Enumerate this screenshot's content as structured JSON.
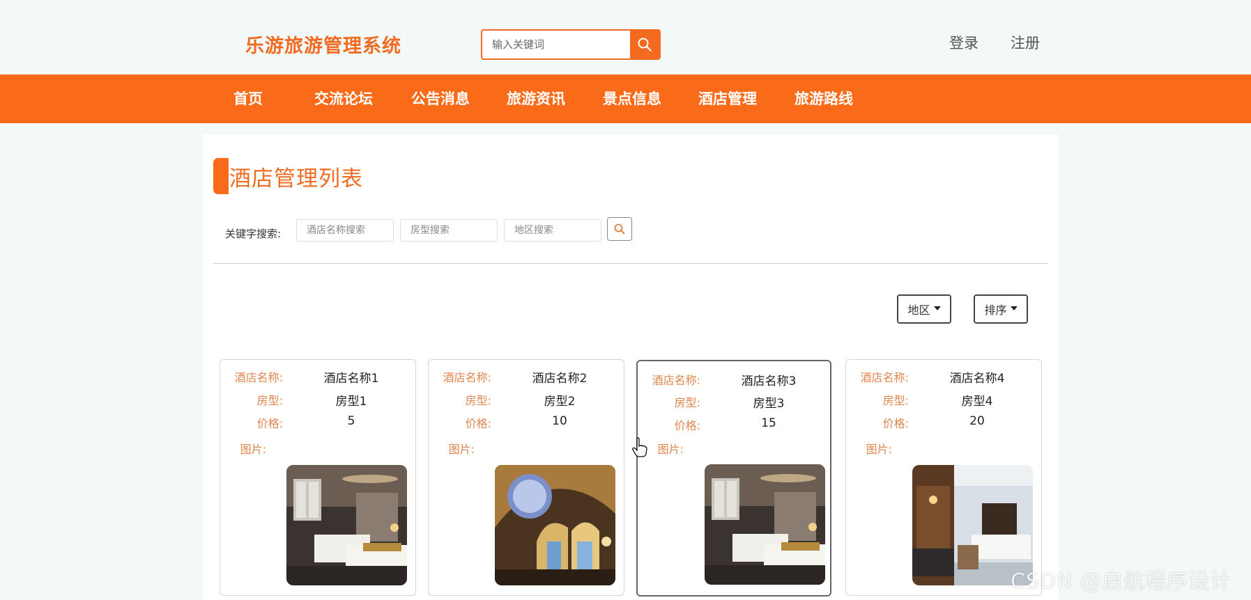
{
  "header": {
    "logo": "乐游旅游管理系统",
    "search_placeholder": "输入关键词",
    "login": "登录",
    "register": "注册"
  },
  "nav": [
    "首页",
    "交流论坛",
    "公告消息",
    "旅游资讯",
    "景点信息",
    "酒店管理",
    "旅游路线"
  ],
  "page": {
    "title": "酒店管理列表",
    "keyword_label": "关键字搜索:",
    "filters": [
      "酒店名称搜索",
      "房型搜索",
      "地区搜索"
    ],
    "dropdowns": [
      "地区",
      "排序"
    ]
  },
  "card_labels": {
    "name": "酒店名称:",
    "room": "房型:",
    "price": "价格:",
    "image": "图片:"
  },
  "hotels": [
    {
      "name": "酒店名称1",
      "room": "房型1",
      "price": "5"
    },
    {
      "name": "酒店名称2",
      "room": "房型2",
      "price": "10"
    },
    {
      "name": "酒店名称3",
      "room": "房型3",
      "price": "15"
    },
    {
      "name": "酒店名称4",
      "room": "房型4",
      "price": "20"
    }
  ],
  "watermark": "CSDN @启航程序设计",
  "colors": {
    "accent": "#f96b19",
    "label": "#e0864f"
  }
}
